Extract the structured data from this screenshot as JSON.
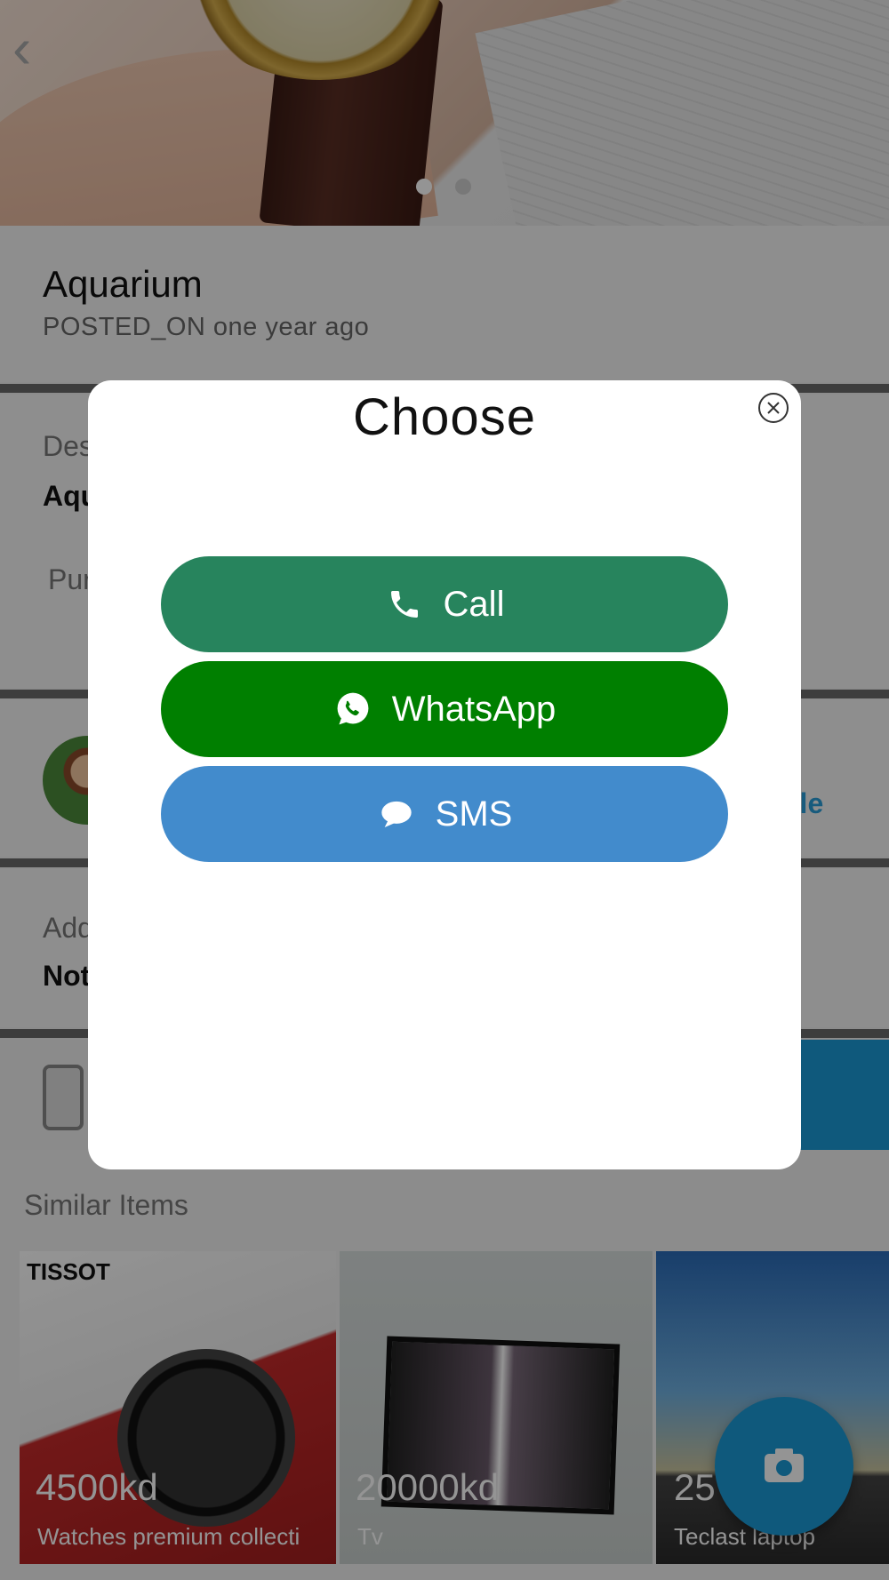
{
  "item": {
    "title": "Aquarium",
    "posted": "POSTED_ON one year ago",
    "description_label": "Des",
    "description_value": "Aqu",
    "purpose_label": "Pur",
    "address_label": "Add",
    "address_value": "Not",
    "profile_link": "file"
  },
  "similar": {
    "heading": "Similar Items",
    "items": [
      {
        "price": "4500kd",
        "caption": "Watches premium collecti",
        "brand": "TISSOT"
      },
      {
        "price": "20000kd",
        "caption": "Tv"
      },
      {
        "price": "25",
        "caption": "Teclast laptop"
      }
    ]
  },
  "dialog": {
    "title": "Choose",
    "buttons": [
      {
        "label": "Call",
        "icon": "phone-icon",
        "color": "#27845d"
      },
      {
        "label": "WhatsApp",
        "icon": "whatsapp-icon",
        "color": "#007f00"
      },
      {
        "label": "SMS",
        "icon": "chat-bubble-icon",
        "color": "#428bcc"
      }
    ]
  },
  "colors": {
    "accent": "#1a9ad6",
    "overlay": "rgba(0,0,0,0.42)"
  }
}
